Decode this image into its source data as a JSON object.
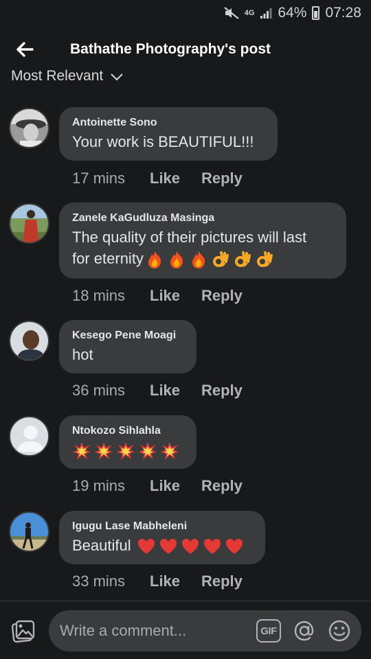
{
  "status_bar": {
    "network": "4G",
    "battery": "64%",
    "time": "07:28"
  },
  "header": {
    "title": "Bathathe Photography's post"
  },
  "sort": {
    "label": "Most Relevant"
  },
  "comments": [
    {
      "author": "Antoinette Sono",
      "text": "Your work is BEAUTIFUL!!!",
      "time": "17 mins",
      "like": "Like",
      "reply": "Reply",
      "avatar": "bw-portrait"
    },
    {
      "author": "Zanele KaGudluza Masinga",
      "text_line1": "The quality of their pictures will last",
      "text_line2": "for eternity",
      "emojis": [
        "fire",
        "fire",
        "fire",
        "ok-hand",
        "ok-hand",
        "ok-hand"
      ],
      "time": "18 mins",
      "like": "Like",
      "reply": "Reply",
      "avatar": "red-dress"
    },
    {
      "author": "Kesego Pene Moagi",
      "text": "hot",
      "time": "36 mins",
      "like": "Like",
      "reply": "Reply",
      "avatar": "man-portrait"
    },
    {
      "author": "Ntokozo Sihlahla",
      "emojis": [
        "collision",
        "collision",
        "collision",
        "collision",
        "collision"
      ],
      "time": "19 mins",
      "like": "Like",
      "reply": "Reply",
      "avatar": "default-silhouette"
    },
    {
      "author": "Igugu Lase Mabheleni",
      "text": "Beautiful",
      "emojis": [
        "red-heart",
        "red-heart",
        "red-heart",
        "red-heart",
        "red-heart"
      ],
      "time": "33 mins",
      "like": "Like",
      "reply": "Reply",
      "avatar": "outdoor-sky"
    }
  ],
  "composer": {
    "placeholder": "Write a comment...",
    "gif_label": "GIF"
  },
  "colors": {
    "background": "#18191a",
    "bubble": "#3a3b3c",
    "text": "#e4e6eb",
    "secondary_text": "#a8abaf"
  }
}
